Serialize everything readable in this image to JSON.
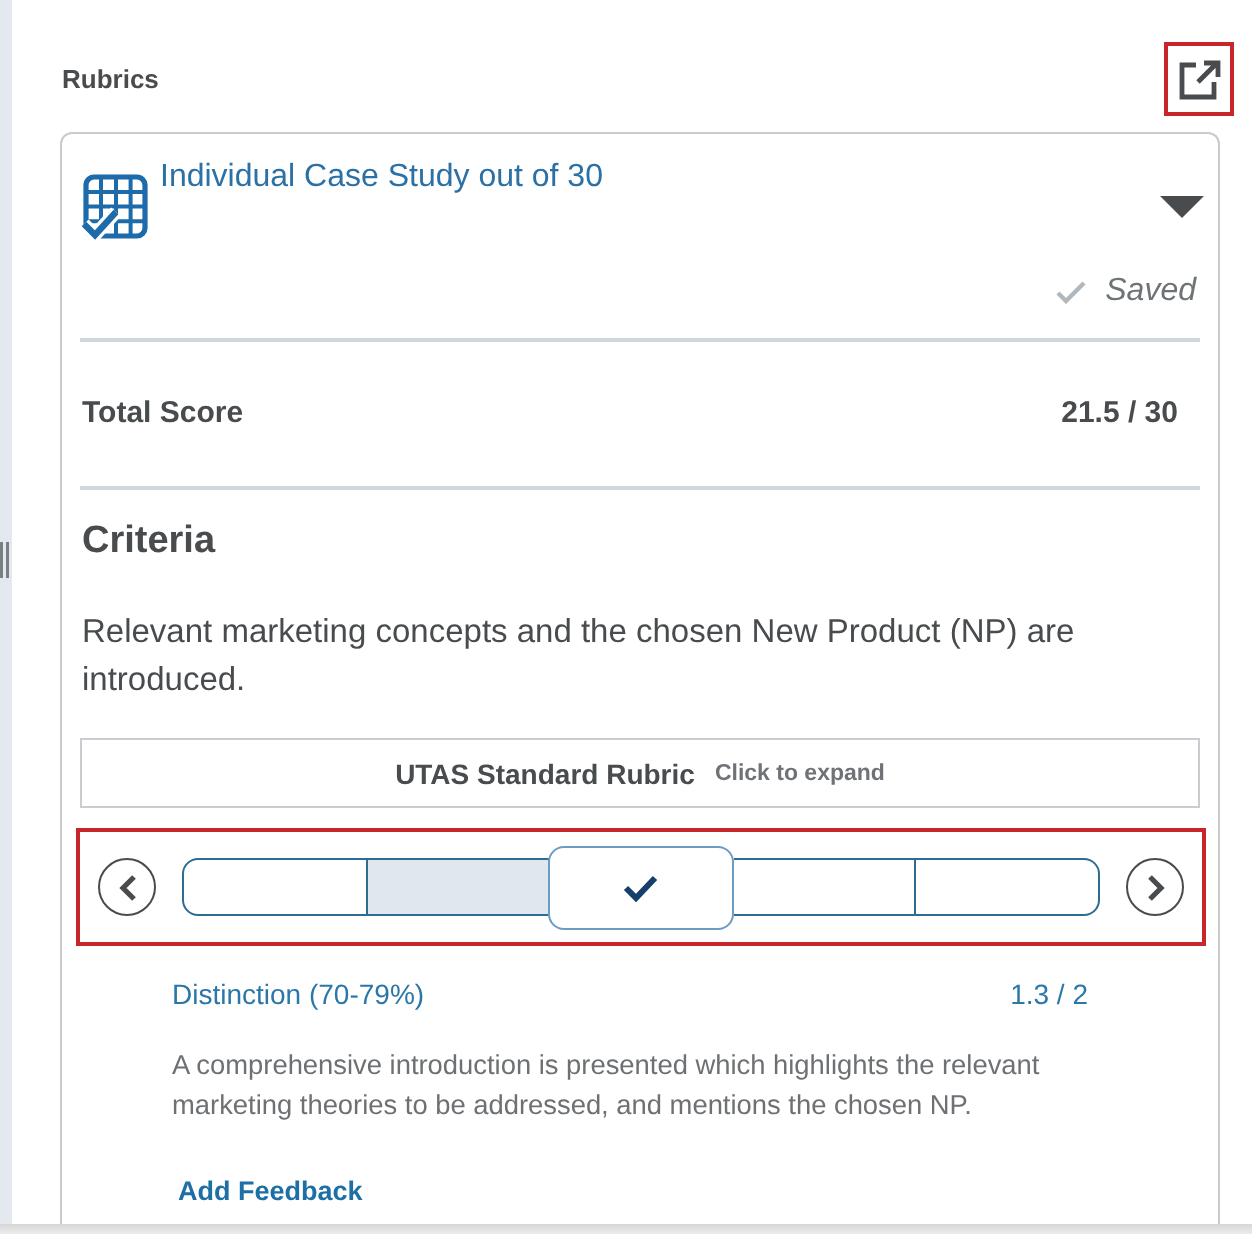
{
  "panel": {
    "title": "Rubrics",
    "popout_highlighted": true
  },
  "rubric": {
    "title": "Individual Case Study out of 30",
    "save_status": "Saved",
    "total_score_label": "Total Score",
    "total_score": "21.5 / 30"
  },
  "criterion": {
    "heading": "Criteria",
    "description": "Relevant marketing concepts and the chosen New Product (NP) are introduced.",
    "rubric_name": "UTAS Standard Rubric",
    "expand_hint": "Click to expand",
    "selector_highlighted": true,
    "levels": [
      {
        "selected": false,
        "hovered": false
      },
      {
        "selected": false,
        "hovered": true
      },
      {
        "selected": true,
        "hovered": false
      },
      {
        "selected": false,
        "hovered": false
      },
      {
        "selected": false,
        "hovered": false
      }
    ],
    "level_name": "Distinction (70-79%)",
    "level_score": "1.3 / 2",
    "level_description": "A comprehensive introduction is presented which highlights the relevant marketing theories to be addressed, and mentions the chosen NP.",
    "feedback_link": "Add Feedback"
  }
}
